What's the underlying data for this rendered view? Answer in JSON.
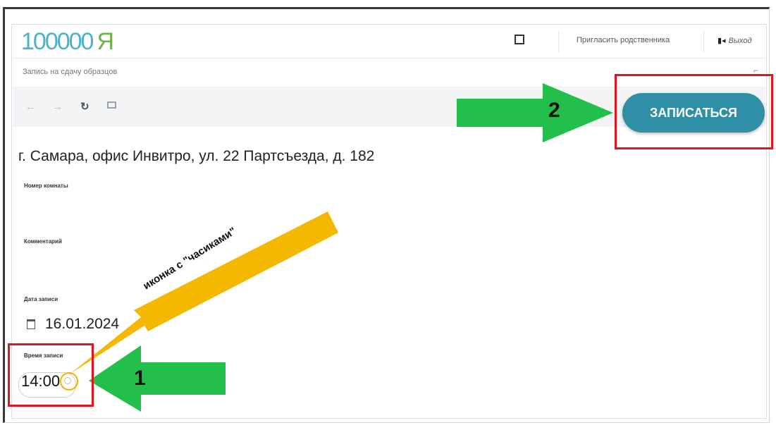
{
  "header": {
    "logo_text": "100000",
    "logo_ya": "Я",
    "invite_label": "Пригласить родственника",
    "logout_label": "Выход"
  },
  "page": {
    "title": "Запись на сдачу образцов",
    "address": "г. Самара, офис Инвитро, ул. 22 Партсъезда, д. 182",
    "labels": {
      "room": "Номер комнаты",
      "comment": "Комментарий",
      "date": "Дата записи",
      "time": "Время записи"
    },
    "date_value": "16.01.2024",
    "time_value": "14:00",
    "submit_label": "ЗАПИСАТЬСЯ"
  },
  "toolbar": {
    "icons": [
      "arrow-left-icon",
      "arrow-right-icon",
      "refresh-icon",
      "mail-icon"
    ]
  },
  "annotations": {
    "step1": "1",
    "step2": "2",
    "clock_hint": "иконка с \"часиками\"",
    "colors": {
      "red": "#e2141e",
      "green": "#22c04a",
      "yellow": "#f5b800",
      "accent": "#2f8fa6"
    }
  }
}
